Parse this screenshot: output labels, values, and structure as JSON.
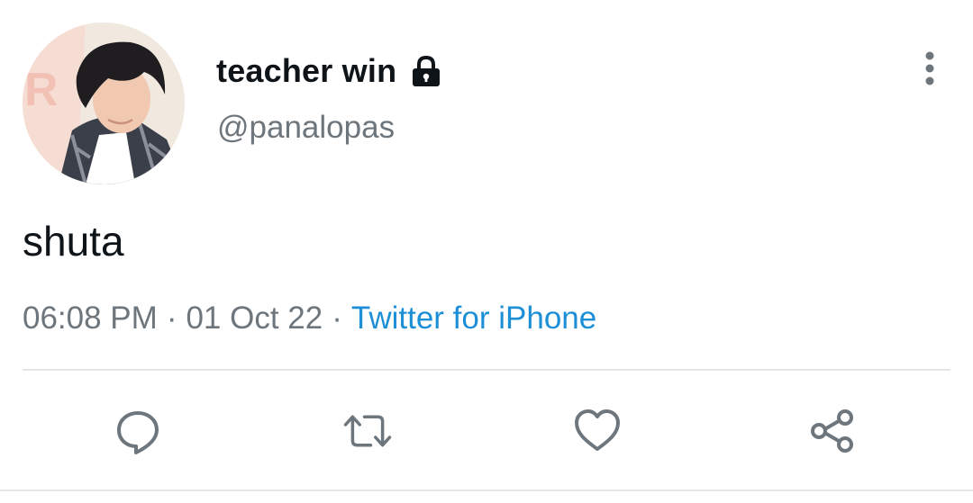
{
  "user": {
    "display_name": "teacher win",
    "handle": "@panalopas",
    "avatar_icon": "profile-photo",
    "protected_icon": "lock-icon"
  },
  "tweet": {
    "text": "shuta",
    "time": "06:08 PM",
    "separator": "·",
    "date": "01 Oct 22",
    "source": "Twitter for iPhone"
  },
  "actions": {
    "more_icon": "more-vertical-icon",
    "reply_icon": "reply-icon",
    "retweet_icon": "retweet-icon",
    "like_icon": "heart-icon",
    "share_icon": "share-icon"
  },
  "colors": {
    "text_primary": "#0f1419",
    "text_secondary": "#6e767d",
    "link": "#1d8fd6",
    "icon": "#6e767d",
    "divider": "#e3e6e8"
  }
}
